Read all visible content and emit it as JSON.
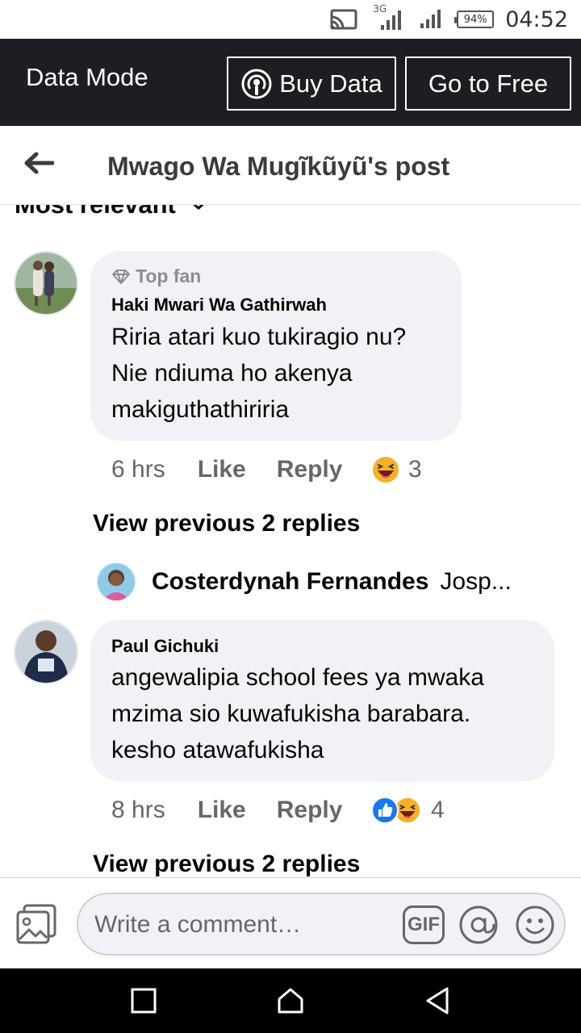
{
  "status_bar": {
    "network_label": "3G",
    "battery": "94%",
    "time": "04:52"
  },
  "data_bar": {
    "mode_label": "Data Mode",
    "buy_label": "Buy Data",
    "free_label": "Go to Free"
  },
  "header": {
    "title": "Mwago Wa Mugĩkũyũ's post"
  },
  "sort": {
    "label": "Most relevant"
  },
  "comments": [
    {
      "badge": "Top fan",
      "author": "Haki Mwari Wa Gathirwah",
      "lines": [
        "Riria atari kuo tukiragio nu?",
        "Nie ndiuma ho akenya",
        "makiguthathiriria"
      ],
      "time": "6 hrs",
      "like": "Like",
      "reply": "Reply",
      "reaction_count": "3",
      "view_previous": "View previous 2 replies",
      "reply_preview": {
        "name": "Costerdynah Fernandes",
        "text": "Josp..."
      }
    },
    {
      "author": "Paul Gichuki",
      "lines": [
        "angewalipia school fees ya mwaka",
        "mzima sio kuwafukisha barabara.",
        "kesho atawafukisha"
      ],
      "time": "8 hrs",
      "like": "Like",
      "reply": "Reply",
      "reaction_count": "4",
      "view_previous": "View previous 2 replies"
    }
  ],
  "composer": {
    "placeholder": "Write a comment…",
    "gif_label": "GIF"
  },
  "colors": {
    "data_bar_bg": "#1c1e21",
    "bubble_bg": "#f0f2f5",
    "secondary_text": "#65676b",
    "like_blue": "#1877f2",
    "haha_yellow": "#f7b125"
  },
  "icons": [
    "cast-icon",
    "signal-icon",
    "podcast-icon",
    "back-arrow-icon",
    "chevron-down-icon",
    "diamond-icon",
    "haha-emoji-icon",
    "like-reaction-icon",
    "photo-icon",
    "at-icon",
    "emoji-icon",
    "nav-recent-icon",
    "nav-home-icon",
    "nav-back-icon"
  ]
}
